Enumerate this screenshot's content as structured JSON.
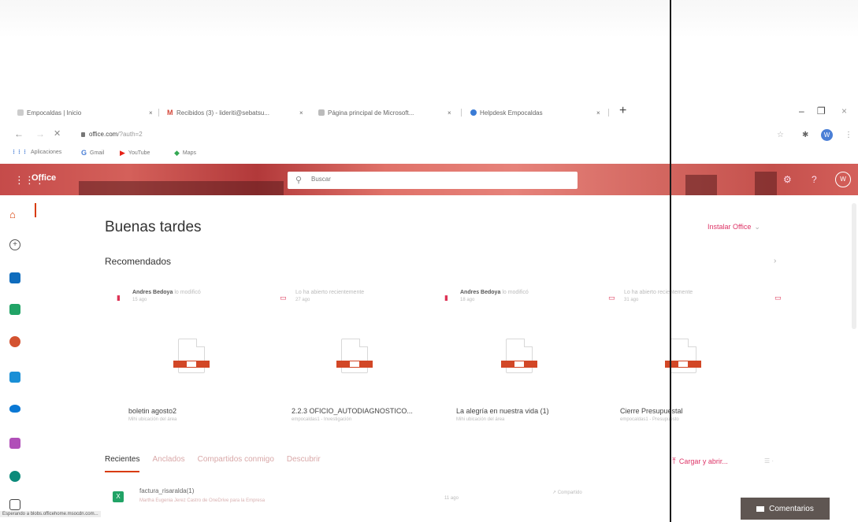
{
  "browser": {
    "tabs": [
      {
        "label": "Empocaldas | Inicio",
        "favicon_color": "#cccccc"
      },
      {
        "label": "Recibidos (3) - lideriti@sebatsu...",
        "favicon_color": "#d44638",
        "favicon_text": "M"
      },
      {
        "label": "Página principal de Microsoft...",
        "favicon_color": "#bbbbbb"
      },
      {
        "label": "Helpdesk Empocaldas",
        "favicon_color": "#3a7bd5"
      }
    ],
    "tab_close": "×",
    "new_tab": "+",
    "window_controls": [
      "–",
      "❐",
      "×"
    ],
    "url_host": "office.com",
    "url_path": "/?auth=2",
    "profile_initial": "W",
    "bookmarks": [
      {
        "icon": "⋮⋮⋮",
        "label": "Aplicaciones",
        "color": "#4a7fd6"
      },
      {
        "icon": "G",
        "label": "Gmail",
        "color": "#4a7fd6"
      },
      {
        "icon": "▶",
        "label": "YouTube",
        "color": "#e62117"
      },
      {
        "icon": "◆",
        "label": "Maps",
        "color": "#34a853"
      }
    ],
    "status": "Esperando a blobs.officehome.msocdn.com..."
  },
  "office": {
    "brand": "Office",
    "search_placeholder": "Buscar",
    "avatar_initial": "W",
    "greeting": "Buenas tardes",
    "install_label": "Instalar Office",
    "recommended_heading": "Recomendados",
    "recommended": [
      {
        "who": "Andres Bedoya",
        "who_rest": "lo modificó",
        "when": "15 ago",
        "name": "boletin agosto2",
        "sub": "Mihi ubicación del área"
      },
      {
        "who": "Lo ha abierto recientemente",
        "who_rest": "",
        "when": "27 ago",
        "name": "2.2.3 OFICIO_AUTODIAGNOSTICO...",
        "sub": "empocaldas1 - Investigación"
      },
      {
        "who": "Andres Bedoya",
        "who_rest": "lo modificó",
        "when": "18 ago",
        "name": "La alegría en nuestra vida (1)",
        "sub": "Mihi ubicación del área"
      },
      {
        "who": "Lo ha abierto recientemente",
        "who_rest": "",
        "when": "31 ago",
        "name": "Cierre Presupuestal",
        "sub": "empocaldas1 - Presupuesto"
      }
    ],
    "recent_tabs": [
      "Recientes",
      "Anclados",
      "Compartidos conmigo",
      "Descubrir"
    ],
    "upload_label": "Cargar y abrir...",
    "sort_label": "☰ ·",
    "files": [
      {
        "name": "factura_risaralda(1)",
        "sub": "Martha Eugenia Jerez Castro de OneDrive para la Empresa",
        "date": "11 ago",
        "share": "Compartido"
      }
    ],
    "feedback_label": "Comentarios"
  },
  "colors": {
    "accent": "#d83b01",
    "header_red": "#c54b4a"
  }
}
